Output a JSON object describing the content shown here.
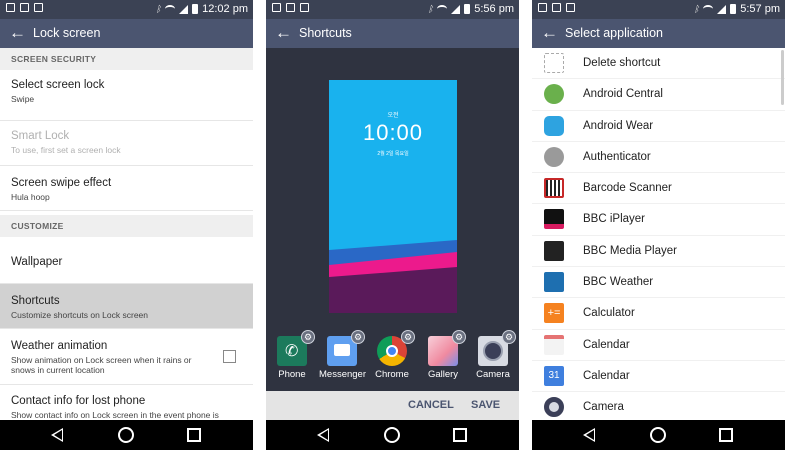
{
  "screen1": {
    "status": {
      "time": "12:02 pm"
    },
    "title": "Lock screen",
    "sections": {
      "security": "SCREEN SECURITY",
      "customize": "CUSTOMIZE"
    },
    "items": {
      "select_lock": {
        "title": "Select screen lock",
        "sub": "Swipe"
      },
      "smart_lock": {
        "title": "Smart Lock",
        "sub": "To use, first set a screen lock"
      },
      "swipe_effect": {
        "title": "Screen swipe effect",
        "sub": "Hula hoop"
      },
      "wallpaper": {
        "title": "Wallpaper"
      },
      "shortcuts": {
        "title": "Shortcuts",
        "sub": "Customize shortcuts on Lock screen"
      },
      "weather": {
        "title": "Weather animation",
        "sub": "Show animation on Lock screen when it rains or snows in current location",
        "checked": false
      },
      "contact": {
        "title": "Contact info for lost phone",
        "sub": "Show contact info on Lock screen in the event phone is"
      }
    }
  },
  "screen2": {
    "status": {
      "time": "5:56 pm"
    },
    "title": "Shortcuts",
    "preview": {
      "ampm": "오전",
      "time": "10:00",
      "date": "2월 2일 목요일"
    },
    "shortcuts": [
      {
        "label": "Phone",
        "color": "#1c7a5c"
      },
      {
        "label": "Messenger",
        "color": "#5f9ff0"
      },
      {
        "label": "Chrome",
        "color": "#e8e8e8"
      },
      {
        "label": "Gallery",
        "color": "#f08aa0"
      },
      {
        "label": "Camera",
        "color": "#3b3f58"
      }
    ],
    "buttons": {
      "cancel": "CANCEL",
      "save": "SAVE"
    }
  },
  "screen3": {
    "status": {
      "time": "5:57 pm"
    },
    "title": "Select application",
    "apps": [
      {
        "name": "Delete shortcut",
        "color": "#ffffff"
      },
      {
        "name": "Android Central",
        "color": "#6ab04c"
      },
      {
        "name": "Android Wear",
        "color": "#2ea3e0"
      },
      {
        "name": "Authenticator",
        "color": "#9a9a9a"
      },
      {
        "name": "Barcode Scanner",
        "color": "#c62828"
      },
      {
        "name": "BBC iPlayer",
        "color": "#d81b60"
      },
      {
        "name": "BBC Media Player",
        "color": "#222222"
      },
      {
        "name": "BBC Weather",
        "color": "#1e6fb0"
      },
      {
        "name": "Calculator",
        "color": "#f58220"
      },
      {
        "name": "Calendar",
        "color": "#f3f3f3"
      },
      {
        "name": "Calendar",
        "color": "#3f7fde"
      },
      {
        "name": "Camera",
        "color": "#3b3f58"
      }
    ]
  }
}
